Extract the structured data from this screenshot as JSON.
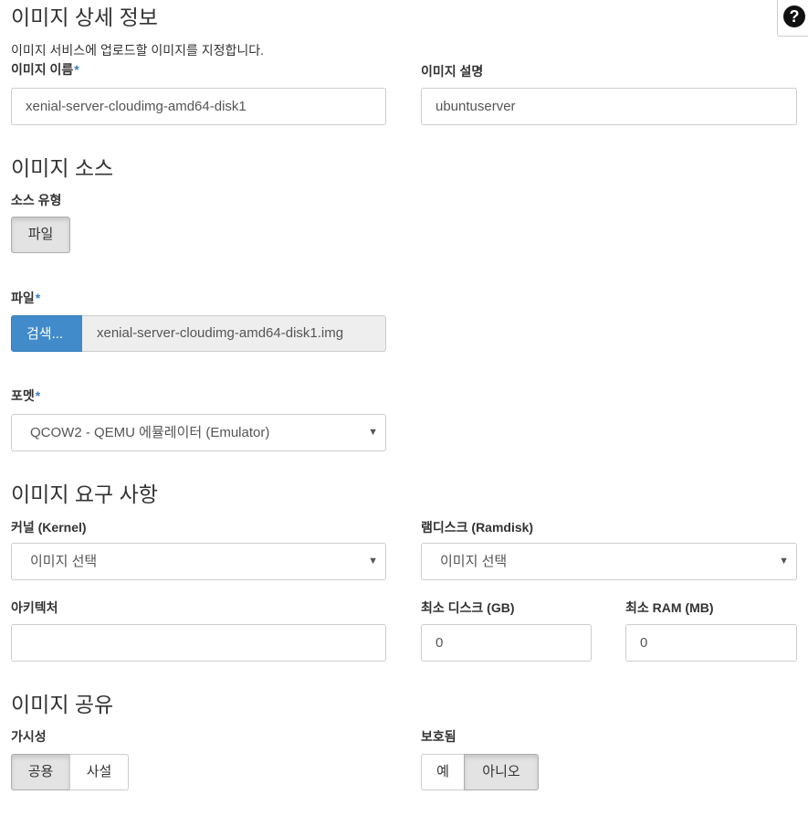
{
  "details": {
    "title": "이미지 상세 정보",
    "description": "이미지 서비스에 업로드할 이미지를 지정합니다.",
    "name_label": "이미지 이름",
    "name_value": "xenial-server-cloudimg-amd64-disk1",
    "desc_label": "이미지 설명",
    "desc_value": "ubuntuserver"
  },
  "source": {
    "title": "이미지 소스",
    "type_label": "소스 유형",
    "type_button": "파일",
    "file_label": "파일",
    "browse_label": "검색...",
    "file_name": "xenial-server-cloudimg-amd64-disk1.img",
    "format_label": "포멧",
    "format_value": "QCOW2 - QEMU 에뮬레이터 (Emulator)"
  },
  "requirements": {
    "title": "이미지 요구 사항",
    "kernel_label": "커널 (Kernel)",
    "kernel_value": "이미지 선택",
    "ramdisk_label": "램디스크 (Ramdisk)",
    "ramdisk_value": "이미지 선택",
    "arch_label": "아키텍처",
    "arch_value": "",
    "min_disk_label": "최소 디스크 (GB)",
    "min_disk_value": "0",
    "min_ram_label": "최소 RAM (MB)",
    "min_ram_value": "0"
  },
  "sharing": {
    "title": "이미지 공유",
    "visibility_label": "가시성",
    "public_label": "공용",
    "private_label": "사설",
    "protected_label": "보호됨",
    "yes_label": "예",
    "no_label": "아니오"
  },
  "required_mark": "*",
  "icons": {
    "help": "help-icon",
    "caret": "caret-down-icon"
  },
  "colors": {
    "accent": "#428bca",
    "required": "#3b7fc4",
    "active_toggle": "#e3e3e3"
  }
}
